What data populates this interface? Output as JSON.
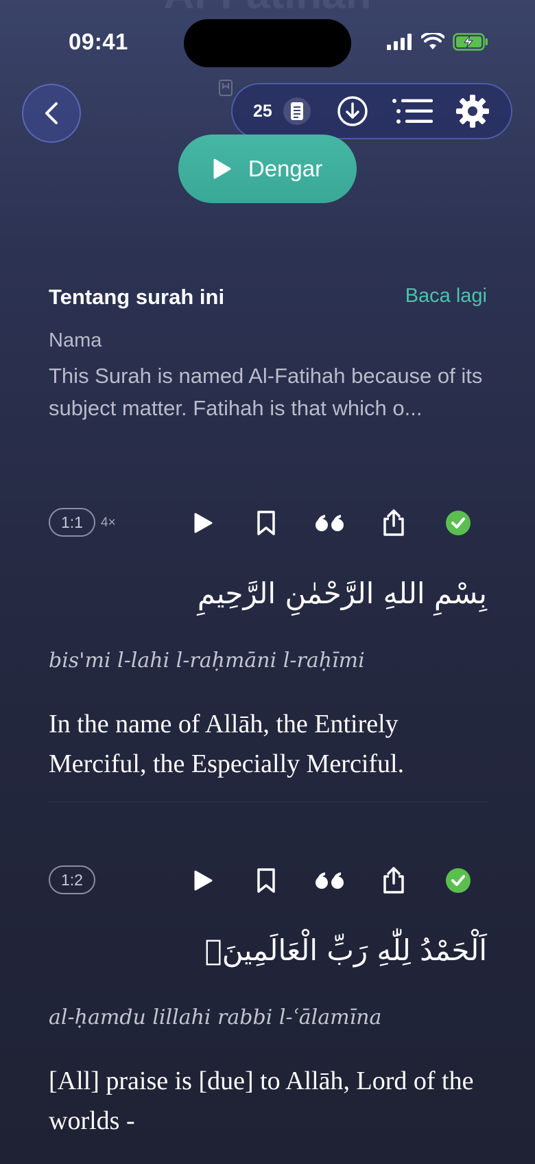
{
  "header": {
    "faded_title": "Al-Fatihah"
  },
  "status_bar": {
    "time": "09:41"
  },
  "toolbar": {
    "page_count": "25",
    "icons": [
      "pages-icon",
      "download-icon",
      "list-icon",
      "gear-icon"
    ]
  },
  "listen_button": {
    "label": "Dengar"
  },
  "about": {
    "title": "Tentang surah ini",
    "read_more": "Baca lagi",
    "subtitle": "Nama",
    "body": "This Surah is named Al-Fatihah because of its subject matter. Fatihah is that which o..."
  },
  "verses": [
    {
      "tag": "1:1",
      "multiplier": "4×",
      "arabic": "بِسْمِ اللهِ الرَّحْمٰنِ الرَّحِيمِ",
      "transliteration": "bis'mi l-lahi l-raḥmāni l-raḥīmi",
      "translation": "In the name of Allāh, the Entirely Merciful, the Especially Merciful."
    },
    {
      "tag": "1:2",
      "multiplier": "",
      "arabic": "اَلْحَمْدُ لِلّٰهِ رَبِّ الْعَالَمِينَۙ",
      "transliteration": "al-ḥamdu lillahi rabbi l-ʿālamīna",
      "translation": "[All] praise is [due] to Allāh, Lord of the worlds -"
    }
  ],
  "colors": {
    "accent": "#46b7a4",
    "check": "#5bbf4f",
    "background": "#2a2f4a"
  }
}
